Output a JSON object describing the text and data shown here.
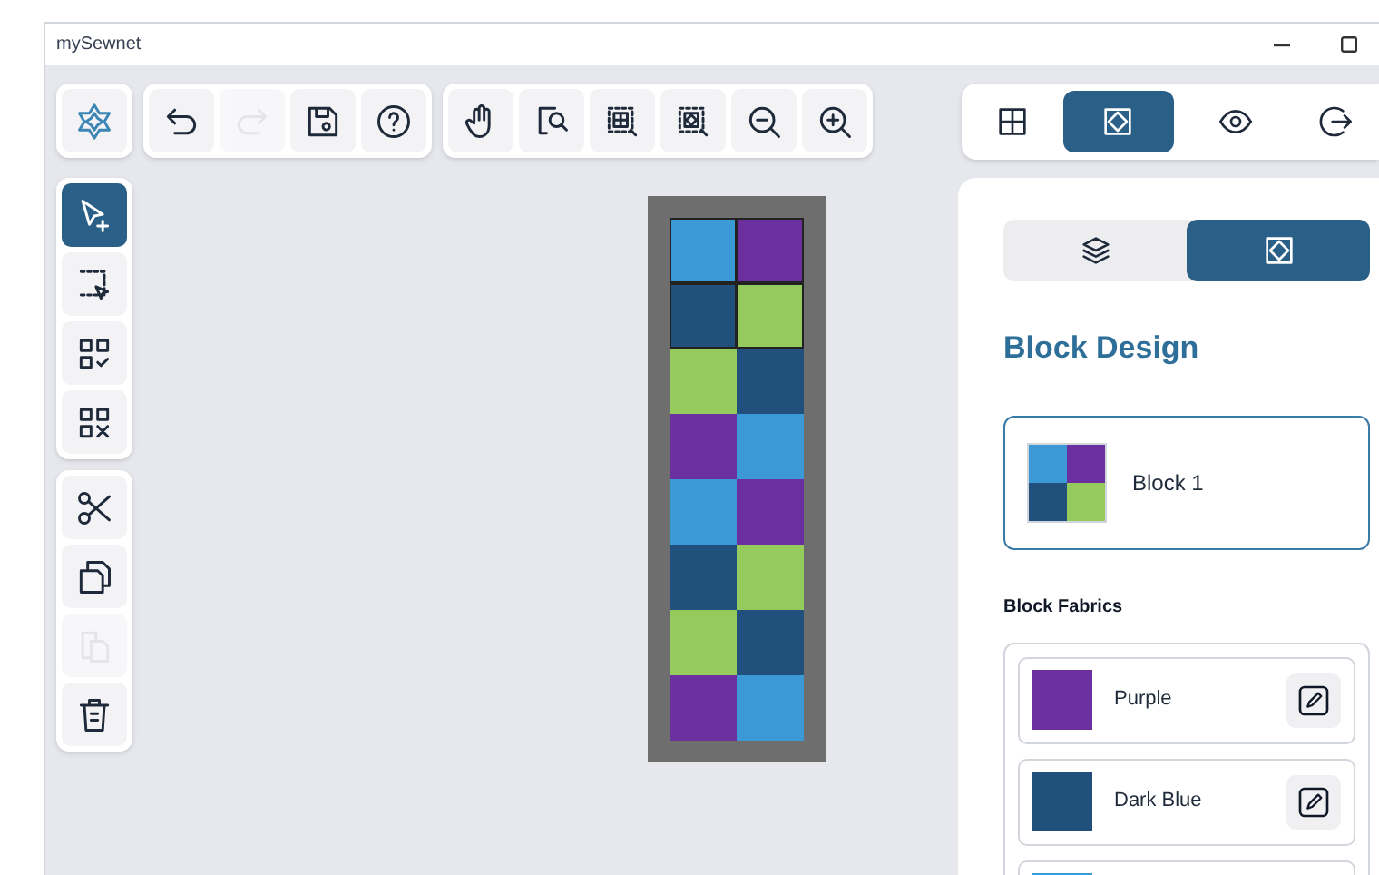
{
  "window": {
    "title": "mySewnet"
  },
  "top_toolbar": {
    "groups": [
      [
        {
          "kind": "logo",
          "selected": false,
          "disabled": false
        }
      ],
      [
        {
          "kind": "undo",
          "selected": false,
          "disabled": false
        },
        {
          "kind": "redo",
          "selected": false,
          "disabled": true
        },
        {
          "kind": "save",
          "selected": false,
          "disabled": false
        },
        {
          "kind": "help",
          "selected": false,
          "disabled": false
        }
      ],
      [
        {
          "kind": "pan",
          "selected": false,
          "disabled": false
        },
        {
          "kind": "zoom-page",
          "selected": false,
          "disabled": false
        },
        {
          "kind": "zoom-grid",
          "selected": false,
          "disabled": false
        },
        {
          "kind": "zoom-block",
          "selected": false,
          "disabled": false
        },
        {
          "kind": "zoom-out",
          "selected": false,
          "disabled": false
        },
        {
          "kind": "zoom-in",
          "selected": false,
          "disabled": false
        }
      ]
    ]
  },
  "mode_tabs": [
    {
      "kind": "grid",
      "selected": false
    },
    {
      "kind": "block",
      "selected": true
    },
    {
      "kind": "view",
      "selected": false
    },
    {
      "kind": "exit",
      "selected": false
    }
  ],
  "side_toolbar": {
    "groups": [
      [
        {
          "kind": "select-add",
          "selected": true,
          "disabled": false
        },
        {
          "kind": "marquee",
          "selected": false,
          "disabled": false
        },
        {
          "kind": "select-all",
          "selected": false,
          "disabled": false
        },
        {
          "kind": "deselect",
          "selected": false,
          "disabled": false
        }
      ],
      [
        {
          "kind": "cut",
          "selected": false,
          "disabled": false
        },
        {
          "kind": "copy",
          "selected": false,
          "disabled": false
        },
        {
          "kind": "paste",
          "selected": false,
          "disabled": true
        },
        {
          "kind": "delete",
          "selected": false,
          "disabled": false
        }
      ]
    ]
  },
  "quilt": {
    "rows": [
      {
        "cells": [
          {
            "color": "#3b9ad6",
            "selected": true
          },
          {
            "color": "#6b2f9e",
            "selected": true
          }
        ]
      },
      {
        "cells": [
          {
            "color": "#22507d",
            "selected": true
          },
          {
            "color": "#95cb5c",
            "selected": true
          }
        ]
      },
      {
        "cells": [
          {
            "color": "#95cb5c",
            "selected": false
          },
          {
            "color": "#22507d",
            "selected": false
          }
        ]
      },
      {
        "cells": [
          {
            "color": "#6b2f9e",
            "selected": false
          },
          {
            "color": "#3b9ad6",
            "selected": false
          }
        ]
      },
      {
        "cells": [
          {
            "color": "#3b9ad6",
            "selected": false
          },
          {
            "color": "#6b2f9e",
            "selected": false
          }
        ]
      },
      {
        "cells": [
          {
            "color": "#22507d",
            "selected": false
          },
          {
            "color": "#95cb5c",
            "selected": false
          }
        ]
      },
      {
        "cells": [
          {
            "color": "#95cb5c",
            "selected": false
          },
          {
            "color": "#22507d",
            "selected": false
          }
        ]
      },
      {
        "cells": [
          {
            "color": "#6b2f9e",
            "selected": false
          },
          {
            "color": "#3b9ad6",
            "selected": false
          }
        ]
      }
    ]
  },
  "panel_tabs": [
    {
      "kind": "layers",
      "selected": false
    },
    {
      "kind": "block",
      "selected": true
    }
  ],
  "panel": {
    "heading": "Block Design",
    "blocks": [
      {
        "name": "Block 1",
        "selected": true,
        "swatch": [
          {
            "color": "#3b9ad6"
          },
          {
            "color": "#6b2f9e"
          },
          {
            "color": "#22507d"
          },
          {
            "color": "#95cb5c"
          }
        ]
      }
    ],
    "fabrics_heading": "Block Fabrics",
    "fabrics": [
      {
        "name": "Purple",
        "color": "#6b2f9e"
      },
      {
        "name": "Dark Blue",
        "color": "#22507d"
      },
      {
        "color": "#3b9ad6"
      }
    ]
  }
}
